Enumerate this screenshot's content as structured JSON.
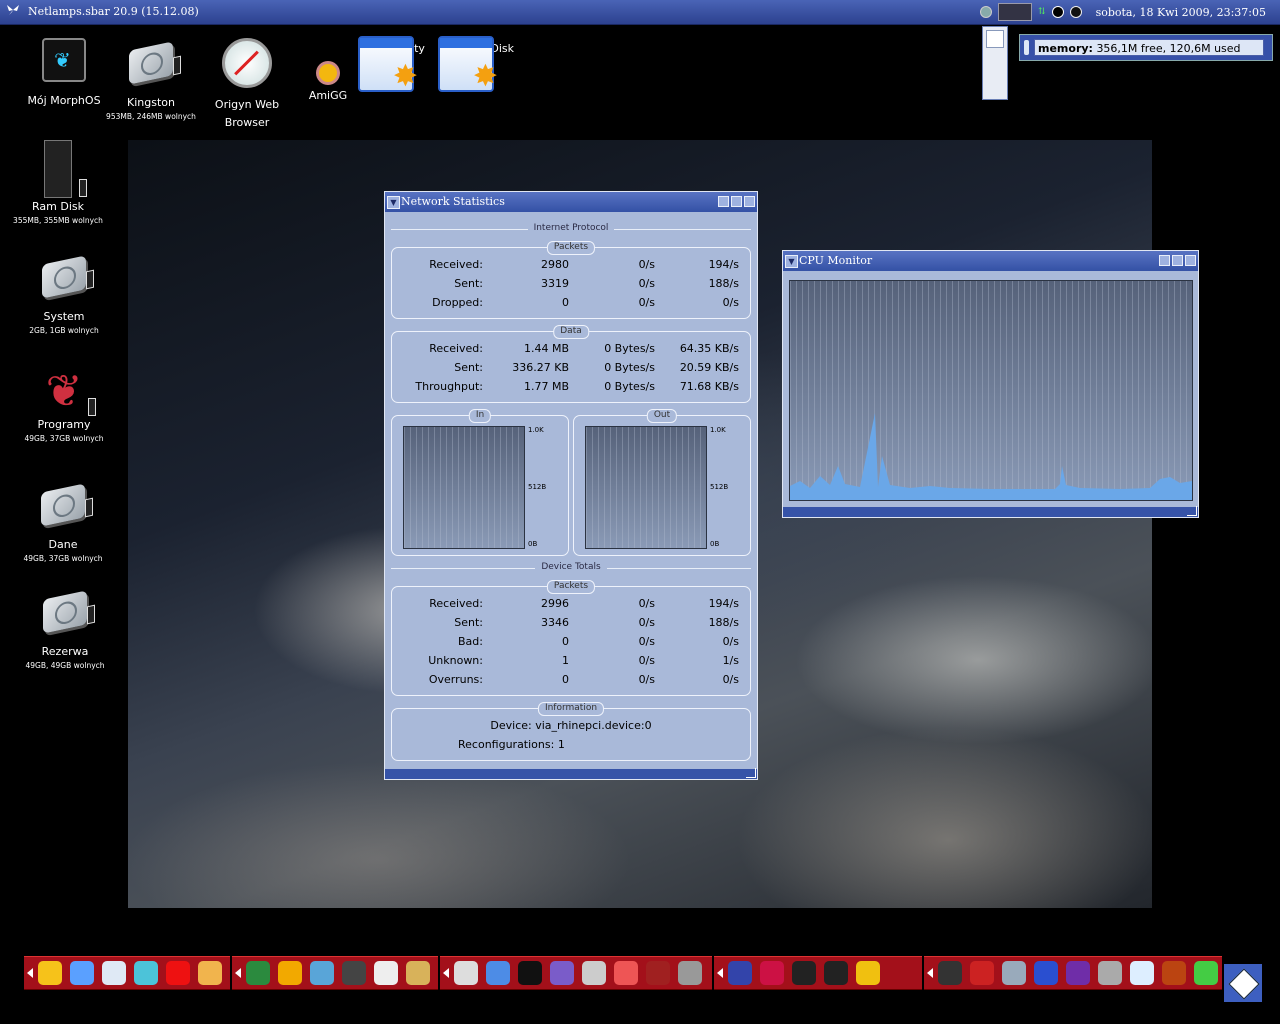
{
  "screenbar": {
    "title": "Netlamps.sbar 20.9 (15.12.08)",
    "clock": "sobota, 18 Kwi 2009, 23:37:05"
  },
  "memory": {
    "label": "memory:",
    "value": "356,1M free, 120,6M used"
  },
  "desktop_icons": [
    {
      "label": "Mój MorphOS",
      "sub": ""
    },
    {
      "label": "Kingston",
      "sub": "953MB, 246MB wolnych"
    },
    {
      "label": "Origyn Web Browser",
      "sub": ""
    },
    {
      "label": "AmiGG",
      "sub": ""
    },
    {
      "label": "zrzuty",
      "sub": ""
    },
    {
      "label": "Ram Disk",
      "sub": ""
    },
    {
      "label": "Ram Disk",
      "sub": "355MB, 355MB wolnych"
    },
    {
      "label": "System",
      "sub": "2GB, 1GB wolnych"
    },
    {
      "label": "Programy",
      "sub": "49GB, 37GB wolnych"
    },
    {
      "label": "Dane",
      "sub": "49GB, 37GB wolnych"
    },
    {
      "label": "Rezerwa",
      "sub": "49GB, 49GB wolnych"
    }
  ],
  "netstat": {
    "title": "Network Statistics",
    "ip_header": "Internet Protocol",
    "packets_label": "Packets",
    "packets": [
      {
        "name": "Received:",
        "total": "2980",
        "rate": "0/s",
        "peak": "194/s"
      },
      {
        "name": "Sent:",
        "total": "3319",
        "rate": "0/s",
        "peak": "188/s"
      },
      {
        "name": "Dropped:",
        "total": "0",
        "rate": "0/s",
        "peak": "0/s"
      }
    ],
    "data_label": "Data",
    "data": [
      {
        "name": "Received:",
        "total": "1.44 MB",
        "rate": "0 Bytes/s",
        "peak": "64.35 KB/s"
      },
      {
        "name": "Sent:",
        "total": "336.27 KB",
        "rate": "0 Bytes/s",
        "peak": "20.59 KB/s"
      },
      {
        "name": "Throughput:",
        "total": "1.77 MB",
        "rate": "0 Bytes/s",
        "peak": "71.68 KB/s"
      }
    ],
    "in_label": "In",
    "out_label": "Out",
    "axis": {
      "top": "1.0K",
      "mid": "512B",
      "bottom": "0B"
    },
    "device_header": "Device Totals",
    "device_packets": [
      {
        "name": "Received:",
        "total": "2996",
        "rate": "0/s",
        "peak": "194/s"
      },
      {
        "name": "Sent:",
        "total": "3346",
        "rate": "0/s",
        "peak": "188/s"
      },
      {
        "name": "Bad:",
        "total": "0",
        "rate": "0/s",
        "peak": "0/s"
      },
      {
        "name": "Unknown:",
        "total": "1",
        "rate": "0/s",
        "peak": "1/s"
      },
      {
        "name": "Overruns:",
        "total": "0",
        "rate": "0/s",
        "peak": "0/s"
      }
    ],
    "info_label": "Information",
    "device": "Device: via_rhinepci.device:0",
    "reconfig": "Reconfigurations: 1"
  },
  "cpu": {
    "title": "CPU Monitor"
  }
}
